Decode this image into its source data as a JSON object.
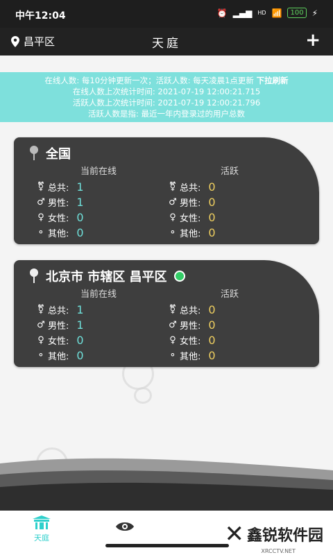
{
  "status_bar": {
    "time": "中午12:04",
    "signal_label": "HD",
    "battery": "100"
  },
  "top_bar": {
    "location": "昌平区",
    "title": "天庭",
    "add_icon": "plus-icon"
  },
  "notice": {
    "line1": "在线人数: 每10分钟更新一次；活跃人数: 每天凌晨1点更新",
    "pull_refresh": "下拉刷新",
    "line2": "在线人数上次统计时间: 2021-07-19 12:00:21.715",
    "line3": "活跃人数上次统计时间: 2021-07-19 12:00:21.796",
    "line4": "活跃人数是指: 最近一年内登录过的用户总数"
  },
  "cards": [
    {
      "title": "全国",
      "online_header": "当前在线",
      "active_header": "活跃",
      "rows": [
        {
          "label": "总共:",
          "online": "1",
          "active": "0"
        },
        {
          "label": "男性:",
          "online": "1",
          "active": "0"
        },
        {
          "label": "女性:",
          "online": "0",
          "active": "0"
        },
        {
          "label": "其他:",
          "online": "0",
          "active": "0"
        }
      ]
    },
    {
      "title": "北京市 市辖区 昌平区",
      "online_header": "当前在线",
      "active_header": "活跃",
      "rows": [
        {
          "label": "总共:",
          "online": "1",
          "active": "0"
        },
        {
          "label": "男性:",
          "online": "1",
          "active": "0"
        },
        {
          "label": "女性:",
          "online": "0",
          "active": "0"
        },
        {
          "label": "其他:",
          "online": "0",
          "active": "0"
        }
      ]
    }
  ],
  "bottom_nav": {
    "tab1_label": "天庭"
  },
  "watermark": {
    "text": "鑫锐软件园",
    "small": "XRCCTV.NET"
  },
  "colors": {
    "accent": "#2fd0cc",
    "card": "#3e3e3e",
    "notice_bg": "#7ee0dc"
  }
}
